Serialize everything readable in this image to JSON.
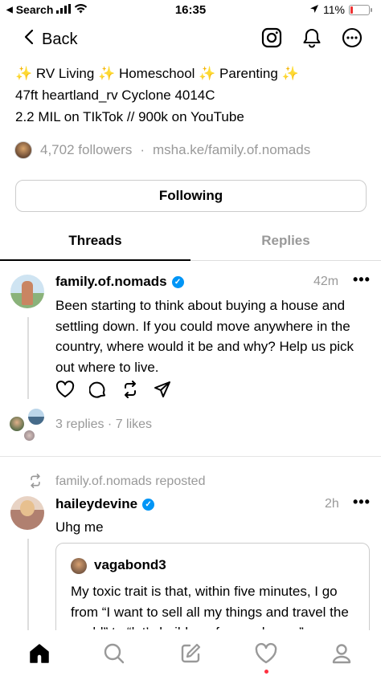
{
  "status_bar": {
    "back_app": "Search",
    "time": "16:35",
    "battery": "11%"
  },
  "nav": {
    "back_label": "Back"
  },
  "profile": {
    "bio_lines": [
      "✨ RV Living ✨ Homeschool ✨ Parenting ✨",
      "47ft heartland_rv Cyclone 4014C",
      "2.2 MIL on TIkTok // 900k on YouTube"
    ],
    "followers": "4,702 followers",
    "separator": "·",
    "link": "msha.ke/family.of.nomads",
    "following_button": "Following"
  },
  "tabs": [
    {
      "label": "Threads",
      "active": true
    },
    {
      "label": "Replies",
      "active": false
    }
  ],
  "posts": [
    {
      "username": "family.of.nomads",
      "verified": true,
      "time": "42m",
      "text": "Been starting to think about buying a house and settling down. If you could move anywhere in the country, where would it be and why?  Help us pick out where to live.",
      "meta": "3 replies · 7 likes"
    },
    {
      "repost_label": "family.of.nomads reposted",
      "username": "haileydevine",
      "verified": true,
      "time": "2h",
      "text": "Uhg me",
      "quote": {
        "username": "vagabond3",
        "text": "My toxic trait is that, within five minutes, I go from “I want to sell all my things and travel the world” to “let’s build our forever house”"
      }
    }
  ],
  "colors": {
    "verified": "#0095f6",
    "muted": "#999999",
    "notification_dot": "#ff3040"
  }
}
